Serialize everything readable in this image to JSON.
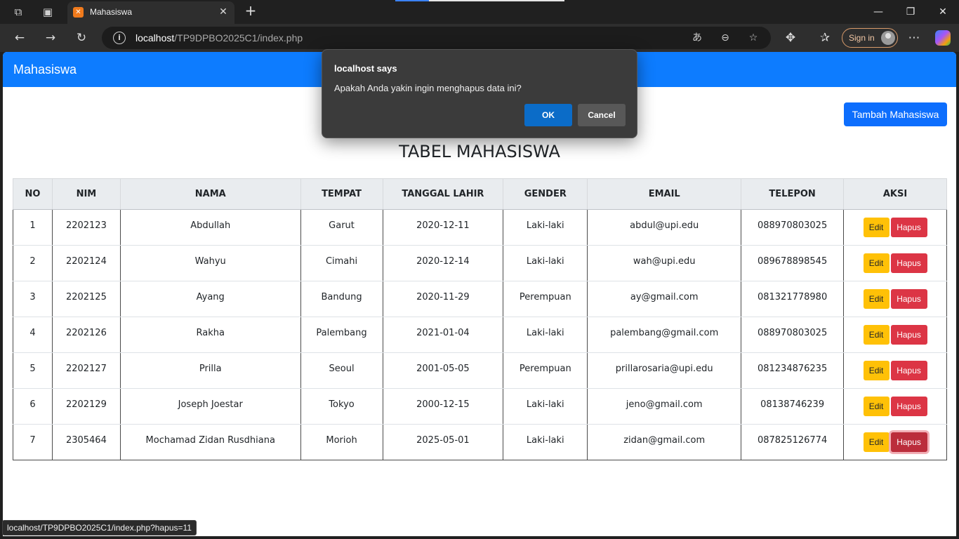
{
  "browser": {
    "tab_title": "Mahasiswa",
    "tab_favicon": "xampp-icon",
    "url_host": "localhost",
    "url_path": "/TP9DPBO2025C1/index.php",
    "sign_in_label": "Sign in",
    "status_url": "localhost/TP9DPBO2025C1/index.php?hapus=11",
    "icons": {
      "workspaces": "⧉",
      "tab_actions": "▣",
      "tab_close": "✕",
      "new_tab": "+",
      "minimize": "—",
      "maximize": "❐",
      "close": "✕",
      "back": "←",
      "forward": "→",
      "reload": "↻",
      "info": "i",
      "read_aloud": "あ",
      "zoom_out": "⊖",
      "favorite": "☆",
      "extensions": "✥",
      "favorites": "✰",
      "more": "⋯"
    }
  },
  "app": {
    "brand": "Mahasiswa",
    "add_button": "Tambah Mahasiswa",
    "title": "TABEL MAHASISWA",
    "columns": [
      "NO",
      "NIM",
      "NAMA",
      "TEMPAT",
      "TANGGAL LAHIR",
      "GENDER",
      "EMAIL",
      "TELEPON",
      "AKSI"
    ],
    "edit_label": "Edit",
    "delete_label": "Hapus",
    "rows": [
      [
        "1",
        "2202123",
        "Abdullah",
        "Garut",
        "2020-12-11",
        "Laki-laki",
        "abdul@upi.edu",
        "088970803025"
      ],
      [
        "2",
        "2202124",
        "Wahyu",
        "Cimahi",
        "2020-12-14",
        "Laki-laki",
        "wah@upi.edu",
        "089678898545"
      ],
      [
        "3",
        "2202125",
        "Ayang",
        "Bandung",
        "2020-11-29",
        "Perempuan",
        "ay@gmail.com",
        "081321778980"
      ],
      [
        "4",
        "2202126",
        "Rakha",
        "Palembang",
        "2021-01-04",
        "Laki-laki",
        "palembang@gmail.com",
        "088970803025"
      ],
      [
        "5",
        "2202127",
        "Prilla",
        "Seoul",
        "2001-05-05",
        "Perempuan",
        "prillarosaria@upi.edu",
        "081234876235"
      ],
      [
        "6",
        "2202129",
        "Joseph Joestar",
        "Tokyo",
        "2000-12-15",
        "Laki-laki",
        "jeno@gmail.com",
        "08138746239"
      ],
      [
        "7",
        "2305464",
        "Mochamad Zidan Rusdhiana",
        "Morioh",
        "2025-05-01",
        "Laki-laki",
        "zidan@gmail.com",
        "087825126774"
      ]
    ]
  },
  "dialog": {
    "title": "localhost says",
    "message": "Apakah Anda yakin ingin menghapus data ini?",
    "ok_label": "OK",
    "cancel_label": "Cancel"
  },
  "colors": {
    "navbar": "#0d7cff",
    "primary_button": "#0d6efd",
    "edit_button": "#ffc107",
    "delete_button": "#dc3545",
    "dialog_bg": "#3b3b3b",
    "dialog_ok": "#0b6cc8"
  }
}
